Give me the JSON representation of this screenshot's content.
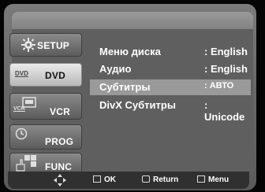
{
  "sidebar": {
    "items": [
      {
        "label": "SETUP",
        "icon": "gear-icon"
      },
      {
        "label": "DVD",
        "icon": "dvd-disc-icon",
        "icon_text": "DVD"
      },
      {
        "label": "VCR",
        "icon": "vcr-cassette-icon",
        "icon_text": "VCR"
      },
      {
        "label": "PROG",
        "icon": "timer-clock-icon"
      },
      {
        "label": "FUNC",
        "icon": "hand-pointer-icon"
      }
    ],
    "active_index": 1
  },
  "menu": {
    "rows": [
      {
        "label": "Меню диска",
        "value": ": English"
      },
      {
        "label": "Аудио",
        "value": ": English"
      },
      {
        "label": "Субтитры",
        "value": ": АВТО"
      },
      {
        "label": "DivX Субтитры",
        "value": ": Unicode"
      }
    ],
    "highlighted_index": 2
  },
  "footer": {
    "move_icon": "dpad-arrows-icon",
    "ok_label": "OK",
    "ok_icon": "enter-icon",
    "return_label": "Return",
    "return_icon": "return-arrow-icon",
    "menu_label": "Menu",
    "menu_icon": "menu-icon"
  }
}
